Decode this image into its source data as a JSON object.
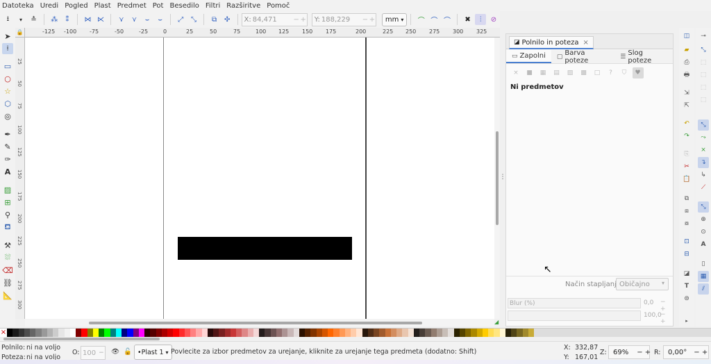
{
  "menu": [
    "Datoteka",
    "Uredi",
    "Pogled",
    "Plast",
    "Predmet",
    "Pot",
    "Besedilo",
    "Filtri",
    "Razširitve",
    "Pomoč"
  ],
  "toolbar": {
    "x_label": "X:",
    "x_value": "84,471",
    "y_label": "Y:",
    "y_value": "188,229",
    "unit": "mm",
    "minus": "−",
    "plus": "+"
  },
  "ruler": {
    "top_ticks": [
      "-125",
      "-100",
      "-75",
      "-50",
      "-25",
      "0",
      "25",
      "50",
      "75",
      "100",
      "125",
      "150",
      "175",
      "200",
      "225",
      "250",
      "275",
      "300",
      "325"
    ],
    "left_ticks": [
      "25",
      "50",
      "75",
      "100",
      "125",
      "150",
      "175",
      "200",
      "225",
      "250",
      "275",
      "300",
      "325"
    ]
  },
  "dialog": {
    "title": "Polnilo in poteza",
    "close": "×",
    "subtabs": [
      "Zapolni",
      "Barva poteze",
      "Slog poteze"
    ],
    "paint_buttons": [
      "×",
      "■",
      "▦",
      "▤",
      "▨",
      "▩",
      "□",
      "?",
      "⛉",
      "♥"
    ],
    "no_objects": "Ni predmetov",
    "blend_label": "Način stapljanja:",
    "blend_value": "Običajno",
    "blur_label": "Blur (%)",
    "blur_value": "0,0",
    "opacity_value": "100,0"
  },
  "palette": {
    "none": "×",
    "colors": [
      "#000000",
      "#1a1a1a",
      "#333333",
      "#4d4d4d",
      "#666666",
      "#808080",
      "#999999",
      "#b3b3b3",
      "#cccccc",
      "#e6e6e6",
      "#f2f2f2",
      "#ffffff",
      "#800000",
      "#ff0000",
      "#808000",
      "#ffff00",
      "#008000",
      "#00ff00",
      "#008080",
      "#00ffff",
      "#000080",
      "#0000ff",
      "#800080",
      "#ff00ff",
      "#2b0000",
      "#550000",
      "#800000",
      "#aa0000",
      "#d40000",
      "#ff0000",
      "#ff2a2a",
      "#ff5555",
      "#ff8080",
      "#ffaaaa",
      "#ffd5d5",
      "#280b0b",
      "#501616",
      "#782121",
      "#a02c2c",
      "#c83737",
      "#d35f5f",
      "#de8787",
      "#e9afaf",
      "#f4d7d7",
      "#241c1c",
      "#483737",
      "#6c5353",
      "#916f6f",
      "#ac9393",
      "#c8b7b7",
      "#e3dbdb",
      "#2b1100",
      "#552200",
      "#803300",
      "#aa4400",
      "#d45500",
      "#ff6600",
      "#ff7f2a",
      "#ff9955",
      "#ffb380",
      "#ffccaa",
      "#ffe6d5",
      "#28170b",
      "#502d16",
      "#784421",
      "#a05a2c",
      "#c87137",
      "#d38d5f",
      "#deaa87",
      "#e9c6af",
      "#f4e3d7",
      "#241f1c",
      "#483e37",
      "#6c5d53",
      "#917c6f",
      "#ac9d93",
      "#c8beb7",
      "#e3dedb",
      "#2b2200",
      "#554400",
      "#806600",
      "#aa8800",
      "#d4aa00",
      "#ffcc00",
      "#ffdd55",
      "#ffe680",
      "#fff6d5",
      "#28220b",
      "#504416",
      "#786721",
      "#a0892c",
      "#c8ab37"
    ]
  },
  "status": {
    "fill_label": "Polnilo:",
    "fill_value": "ni na voljo",
    "stroke_label": "Poteza:",
    "stroke_value": "ni na voljo",
    "opacity_label": "O:",
    "opacity_value": "100",
    "layer": "•Plast 1",
    "message": "Povlecite za izbor predmetov za urejanje, kliknite za urejanje tega predmeta (dodatno: Shift)",
    "cursor_x_label": "X:",
    "cursor_x": "332,87",
    "cursor_y_label": "Y:",
    "cursor_y": "167,01",
    "zoom_label": "Z:",
    "zoom": "69%",
    "rotation_label": "R:",
    "rotation": "0,00°"
  }
}
